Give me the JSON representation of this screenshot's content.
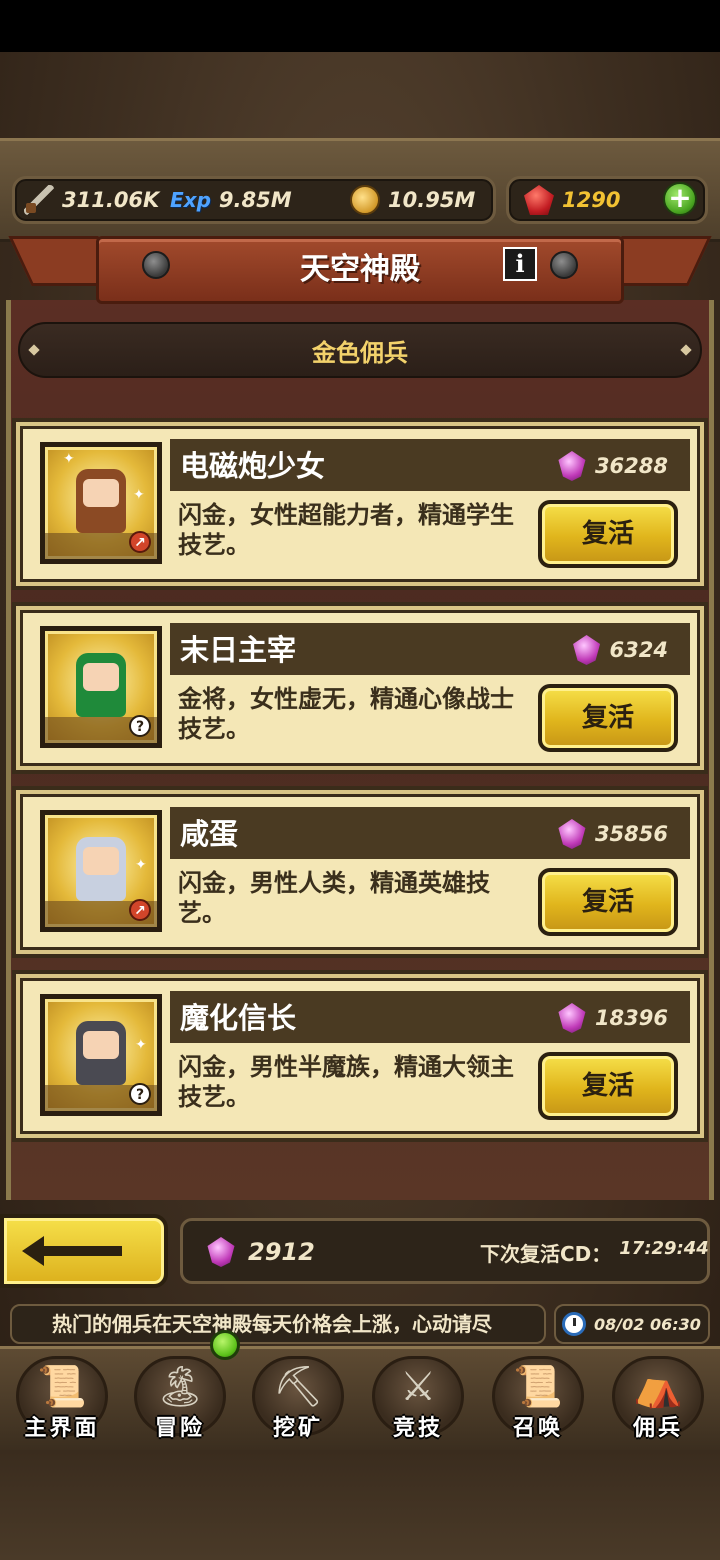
{
  "resources": {
    "attack": "311.06K",
    "exp_label": "Exp",
    "exp": "9.85M",
    "gold": "10.95M",
    "ruby": "1290"
  },
  "header": {
    "title": "天空神殿",
    "info_label": "i",
    "subtitle": "金色佣兵"
  },
  "mercenaries": [
    {
      "name": "电磁炮少女",
      "price": "36288",
      "desc": "闪金，女性超能力者，精通学生技艺。",
      "button": "复活",
      "badge": "o"
    },
    {
      "name": "末日主宰",
      "price": "6324",
      "desc": "金将，女性虚无，精通心像战士技艺。",
      "button": "复活",
      "badge": "?"
    },
    {
      "name": "咸蛋",
      "price": "35856",
      "desc": "闪金，男性人类，精通英雄技艺。",
      "button": "复活",
      "badge": "o"
    },
    {
      "name": "魔化信长",
      "price": "18396",
      "desc": "闪金，男性半魔族，精通大领主技艺。",
      "button": "复活",
      "badge": "?"
    }
  ],
  "footer": {
    "gems": "2912",
    "cd_label": "下次复活CD：",
    "cd_time": "17:29:44",
    "ticker": "热门的佣兵在天空神殿每天价格会上涨，心动请尽",
    "clock": "08/02 06:30"
  },
  "nav": [
    {
      "label": "主界面",
      "icon": "map-scroll-icon"
    },
    {
      "label": "冒险",
      "icon": "island-icon"
    },
    {
      "label": "挖矿",
      "icon": "pickaxe-icon"
    },
    {
      "label": "竞技",
      "icon": "crossed-swords-icon"
    },
    {
      "label": "召唤",
      "icon": "summon-scroll-icon"
    },
    {
      "label": "佣兵",
      "icon": "tent-icon"
    }
  ],
  "colors": {
    "card_bg": "#f4e7b6",
    "revive_button": "#e0b51c",
    "banner": "#a24a2c",
    "gem": "#c03ab8"
  }
}
